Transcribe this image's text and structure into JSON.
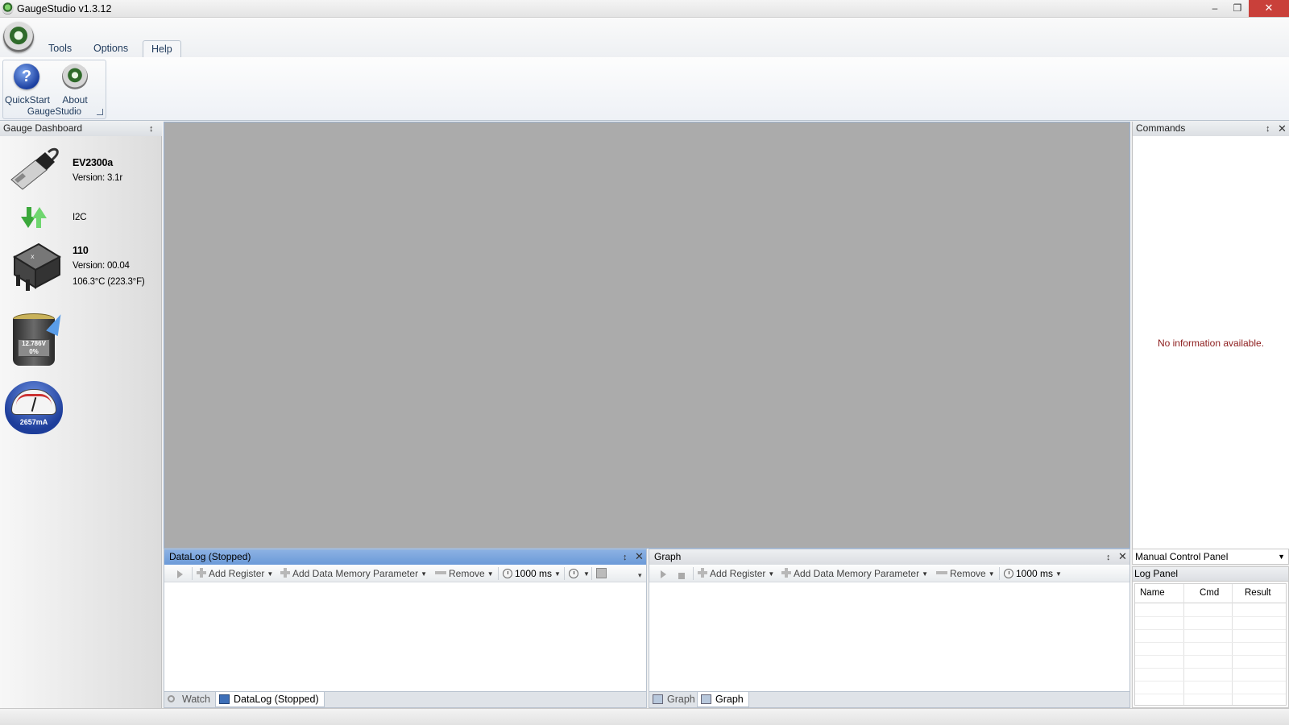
{
  "window": {
    "title": "GaugeStudio v1.3.12",
    "min": "–",
    "max": "❐",
    "close": "✕"
  },
  "menu": {
    "tabs": [
      {
        "label": "Tools"
      },
      {
        "label": "Options"
      },
      {
        "label": "Help",
        "active": true
      }
    ]
  },
  "ribbon": {
    "quickstart_label": "QuickStart",
    "about_label": "About",
    "group_label": "GaugeStudio"
  },
  "dashboard": {
    "title": "Gauge Dashboard",
    "adapter": {
      "name": "EV2300a",
      "version": "Version: 3.1r"
    },
    "bus": {
      "label": "I2C"
    },
    "device": {
      "name": "110",
      "version": "Version: 00.04",
      "temperature": "106.3°C (223.3°F)"
    },
    "battery": {
      "voltage": "12.786V",
      "soc": "0%"
    },
    "current": {
      "reading": "2657mA"
    }
  },
  "datalog": {
    "title": "DataLog (Stopped)",
    "add_register": "Add Register",
    "add_dm": "Add Data Memory Parameter",
    "remove": "Remove",
    "interval": "1000 ms",
    "tabs": [
      {
        "label": "Watch"
      },
      {
        "label": "DataLog (Stopped)"
      }
    ]
  },
  "graph": {
    "title": "Graph",
    "add_register": "Add Register",
    "add_dm": "Add Data Memory Parameter",
    "remove": "Remove",
    "interval": "1000 ms",
    "tabs": [
      {
        "label": "Graph"
      },
      {
        "label": "Graph"
      }
    ]
  },
  "commands": {
    "title": "Commands",
    "empty_message": "No information available."
  },
  "manual_control": {
    "label": "Manual Control Panel"
  },
  "log_panel": {
    "title": "Log Panel",
    "columns": [
      "Name",
      "Cmd",
      "Result"
    ]
  },
  "icons": {
    "pin": "📌",
    "close": "✕"
  }
}
